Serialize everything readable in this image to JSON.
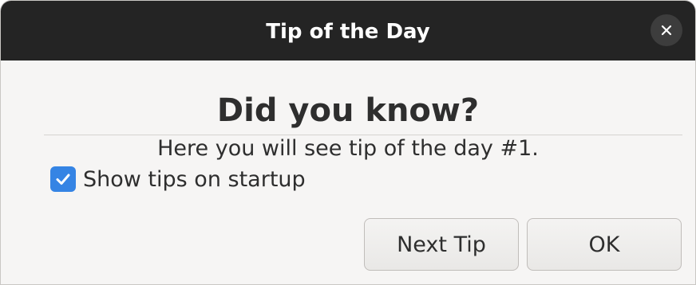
{
  "window": {
    "title": "Tip of the Day"
  },
  "content": {
    "heading": "Did you know?",
    "tip_text": "Here you will see tip of the day #1.",
    "show_tips_label": "Show tips on startup",
    "show_tips_checked": true
  },
  "buttons": {
    "next_tip_label": "Next Tip",
    "ok_label": "OK"
  },
  "icons": {
    "close": "close-icon",
    "check": "checkmark-icon"
  },
  "colors": {
    "titlebar": "#242424",
    "accent": "#3584e4",
    "background": "#f6f5f4"
  }
}
